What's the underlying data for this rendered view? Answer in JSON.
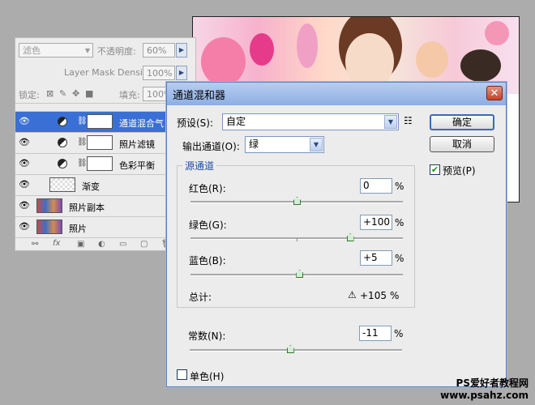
{
  "layers_panel": {
    "blend_mode": "滤色",
    "opacity_label": "不透明度:",
    "opacity_value": "60%",
    "mask_density_label": "Layer Mask Density",
    "mask_density_value": "100%",
    "lock_label": "锁定:",
    "fill_label": "填充:",
    "fill_value": "100%",
    "layers": [
      {
        "name": "通道混合气",
        "selected": true,
        "type": "adjustment"
      },
      {
        "name": "照片滤镜",
        "selected": false,
        "type": "adjustment"
      },
      {
        "name": "色彩平衡",
        "selected": false,
        "type": "adjustment"
      },
      {
        "name": "渐变",
        "selected": false,
        "type": "gradient"
      },
      {
        "name": "照片副本",
        "selected": false,
        "type": "photo"
      },
      {
        "name": "照片",
        "selected": false,
        "type": "photo"
      }
    ],
    "footer_icons": [
      "link-icon",
      "fx-icon",
      "mask-icon",
      "adjustment-icon",
      "folder-icon",
      "new-layer-icon",
      "trash-icon"
    ]
  },
  "dialog": {
    "title": "通道混和器",
    "close_glyph": "✕",
    "preset_label": "预设(S):",
    "preset_value": "自定",
    "output_channel_label": "输出通道(O):",
    "output_channel_value": "绿",
    "source_group_title": "源通道",
    "channels": [
      {
        "label": "红色(R):",
        "value": "0",
        "percent": 0
      },
      {
        "label": "绿色(G):",
        "value": "+100",
        "percent": 100
      },
      {
        "label": "蓝色(B):",
        "value": "+5",
        "percent": 5
      }
    ],
    "pct_sign": "%",
    "total_label": "总计:",
    "total_value": "+105",
    "constant_label": "常数(N):",
    "constant_value": "-11",
    "constant_percent": -11,
    "monochrome_label": "单色(H)",
    "monochrome_checked": false,
    "ok_label": "确定",
    "cancel_label": "取消",
    "preview_label": "预览(P)",
    "preview_checked": true
  },
  "watermark": {
    "line1": "PS爱好者教程网",
    "line2": "www.psahz.com"
  }
}
